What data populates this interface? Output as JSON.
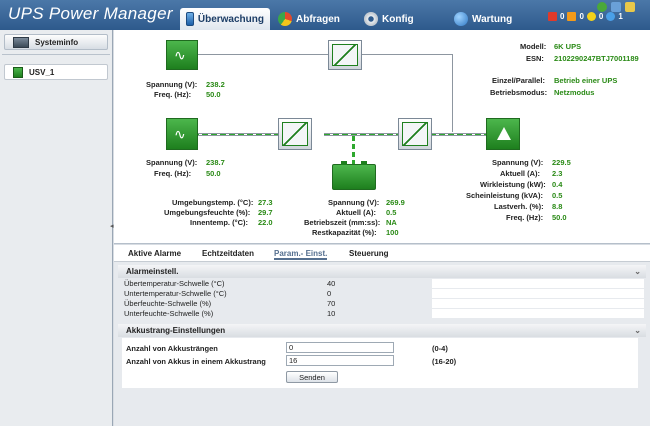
{
  "app": {
    "title": "UPS Power Manager"
  },
  "nav": {
    "tabs": [
      {
        "label": "Überwachung"
      },
      {
        "label": "Abfragen"
      },
      {
        "label": "Konfig"
      },
      {
        "label": "Wartung"
      }
    ]
  },
  "alarms": {
    "critical": "0",
    "major": "0",
    "minor": "0",
    "warning": "1"
  },
  "sidebar": {
    "items": [
      {
        "label": "Systeminfo"
      },
      {
        "label": "USV_1"
      }
    ]
  },
  "diagram": {
    "bypass": {
      "voltage_label": "Spannung (V):",
      "voltage": "238.2",
      "freq_label": "Freq. (Hz):",
      "freq": "50.0"
    },
    "mains": {
      "voltage_label": "Spannung (V):",
      "voltage": "238.7",
      "freq_label": "Freq. (Hz):",
      "freq": "50.0"
    },
    "env": {
      "temp_label": "Umgebungstemp. (°C):",
      "temp": "27.3",
      "humidity_label": "Umgebungsfeuchte (%):",
      "humidity": "29.7",
      "inner_label": "Innentemp. (°C):",
      "inner": "22.0"
    },
    "battery": {
      "voltage_label": "Spannung (V):",
      "voltage": "269.9",
      "current_label": "Aktuell (A):",
      "current": "0.5",
      "runtime_label": "Betriebszeit (mm:ss):",
      "runtime": "NA",
      "capacity_label": "Restkapazität (%):",
      "capacity": "100"
    },
    "output": {
      "voltage_label": "Spannung (V):",
      "voltage": "229.5",
      "current_label": "Aktuell (A):",
      "current": "2.3",
      "active_label": "Wirkleistung (kW):",
      "active": "0.4",
      "apparent_label": "Scheinleistung (kVA):",
      "apparent": "0.5",
      "load_label": "Lastverh. (%):",
      "load": "8.8",
      "freq_label": "Freq. (Hz):",
      "freq": "50.0"
    },
    "info": {
      "model_label": "Modell:",
      "model": "6K UPS",
      "esn_label": "ESN:",
      "esn": "2102290247BTJ7001189",
      "mode_label": "Einzel/Parallel:",
      "mode": "Betrieb einer UPS",
      "op_label": "Betriebsmodus:",
      "op": "Netzmodus"
    }
  },
  "subtabs": [
    {
      "label": "Aktive Alarme"
    },
    {
      "label": "Echtzeitdaten"
    },
    {
      "label": "Param.- Einst."
    },
    {
      "label": "Steuerung"
    }
  ],
  "alarm_settings": {
    "title": "Alarmeinstell.",
    "rows": [
      {
        "label": "Übertemperatur-Schwelle (°C)",
        "value": "40"
      },
      {
        "label": "Untertemperatur-Schwelle (°C)",
        "value": "0"
      },
      {
        "label": "Überfeuchte-Schwelle (%)",
        "value": "70"
      },
      {
        "label": "Unterfeuchte-Schwelle (%)",
        "value": "10"
      }
    ]
  },
  "battery_settings": {
    "title": "Akkustrang-Einstellungen",
    "rows": [
      {
        "label": "Anzahl von Akkusträngen",
        "value": "0",
        "hint": "(0-4)"
      },
      {
        "label": "Anzahl von Akkus in einem Akkustrang",
        "value": "16",
        "hint": "(16-20)"
      }
    ],
    "send_label": "Senden"
  },
  "colors": {
    "header": "#3a689a",
    "value_green": "#2a8a16",
    "module_green": "#2e9a2e"
  }
}
